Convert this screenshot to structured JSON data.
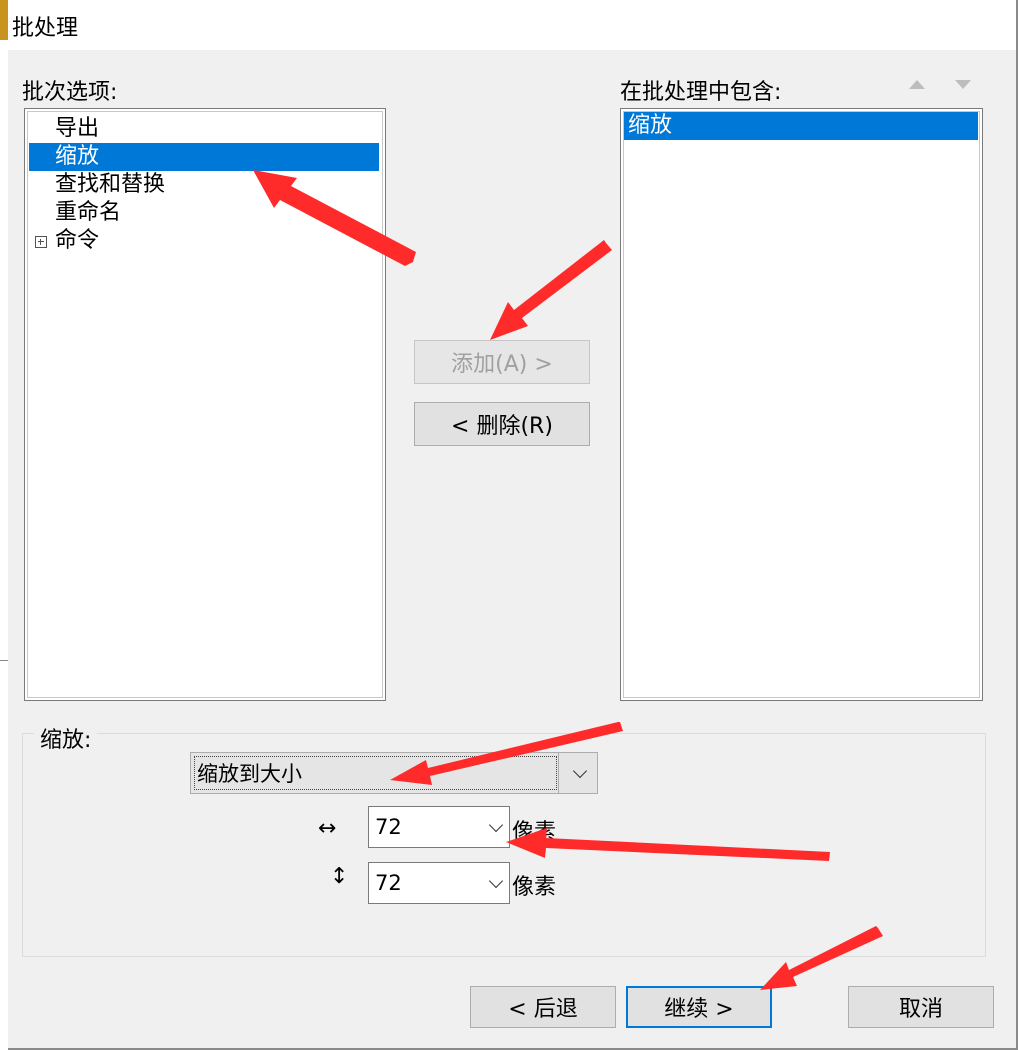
{
  "dialog": {
    "title": "批处理",
    "batch_options_label": "批次选项:",
    "included_label": "在批处理中包含:",
    "batch_options": [
      {
        "label": "导出",
        "selected": false
      },
      {
        "label": "缩放",
        "selected": true
      },
      {
        "label": "查找和替换",
        "selected": false
      },
      {
        "label": "重命名",
        "selected": false
      },
      {
        "label": "命令",
        "selected": false,
        "expandable": true
      }
    ],
    "included_items": [
      {
        "label": "缩放",
        "selected": true
      }
    ],
    "add_button": "添加(A) >",
    "remove_button": "< 删除(R)",
    "scale_group": {
      "label": "缩放:",
      "mode_value": "缩放到大小",
      "width_icon": "↔",
      "width_value": "72",
      "width_unit": "像素",
      "height_icon": "↕",
      "height_value": "72",
      "height_unit": "像素"
    },
    "back_button": "< 后退",
    "continue_button": "继续 >",
    "cancel_button": "取消"
  },
  "annotation_color": "#ff2b2b"
}
